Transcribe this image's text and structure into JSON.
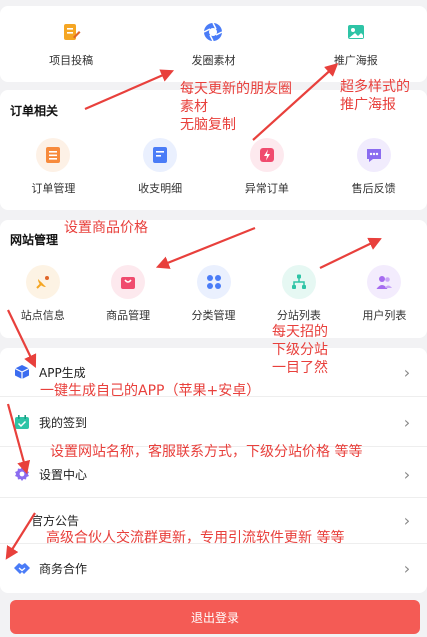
{
  "top_grid": {
    "items": [
      {
        "label": "项目投稿",
        "icon": "edit-doc-icon",
        "color": "#f5a623"
      },
      {
        "label": "发圈素材",
        "icon": "aperture-icon",
        "color": "#4a7cf7"
      },
      {
        "label": "推广海报",
        "icon": "image-icon",
        "color": "#2ec4a6"
      }
    ]
  },
  "orders": {
    "title": "订单相关",
    "items": [
      {
        "label": "订单管理",
        "icon": "list-icon",
        "color": "#f78a3c"
      },
      {
        "label": "收支明细",
        "icon": "receipt-icon",
        "color": "#4a7cf7"
      },
      {
        "label": "异常订单",
        "icon": "alert-bolt-icon",
        "color": "#f04b6e"
      },
      {
        "label": "售后反馈",
        "icon": "chat-icon",
        "color": "#8b6cf0"
      }
    ]
  },
  "site": {
    "title": "网站管理",
    "items": [
      {
        "label": "站点信息",
        "icon": "satellite-icon",
        "color": "#f5a623"
      },
      {
        "label": "商品管理",
        "icon": "shopping-bag-icon",
        "color": "#f04b6e"
      },
      {
        "label": "分类管理",
        "icon": "category-grid-icon",
        "color": "#4a7cf7"
      },
      {
        "label": "分站列表",
        "icon": "tree-icon",
        "color": "#2ec4a6"
      },
      {
        "label": "用户列表",
        "icon": "users-icon",
        "color": "#a66cf0"
      }
    ]
  },
  "menu": {
    "items": [
      {
        "label": "APP生成",
        "icon": "cube-icon",
        "color": "#3c6df0"
      },
      {
        "label": "我的签到",
        "icon": "calendar-check-icon",
        "color": "#2ec4a6"
      },
      {
        "label": "设置中心",
        "icon": "gear-icon",
        "color": "#8b6cf0"
      },
      {
        "label": "官方公告",
        "icon": "megaphone-icon",
        "color": "#f5a623"
      },
      {
        "label": "商务合作",
        "icon": "handshake-icon",
        "color": "#4a7cf7"
      }
    ],
    "chevron": "›"
  },
  "logout_label": "退出登录",
  "annotations": {
    "moments": "每天更新的朋友圈\n素材\n无脑复制",
    "posters": "超多样式的\n推广海报",
    "price": "设置商品价格",
    "substations": "每天招的\n下级分站\n一目了然",
    "app": "一键生成自己的APP（苹果+安卓）",
    "settings": "设置网站名称，客服联系方式，下级分站价格 等等",
    "notice": "高级合伙人交流群更新，专用引流软件更新 等等"
  },
  "colors": {
    "annotation": "#e8403c",
    "logout": "#f45b55",
    "background": "#f2f2f4"
  }
}
